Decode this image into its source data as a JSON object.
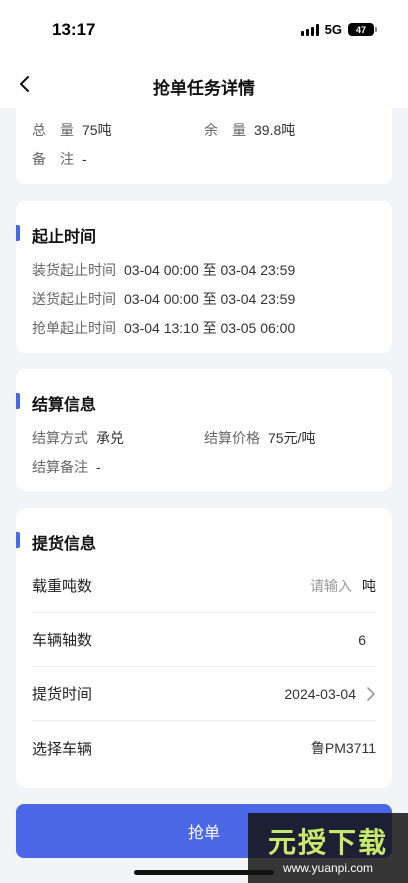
{
  "status": {
    "time": "13:17",
    "network": "5G",
    "battery": "47"
  },
  "nav": {
    "title": "抢单任务详情"
  },
  "summary": {
    "total_label": "总　量",
    "total_value": "75吨",
    "remain_label": "余　量",
    "remain_value": "39.8吨",
    "note_label": "备　注",
    "note_value": "-"
  },
  "time_section": {
    "title": "起止时间",
    "rows": [
      {
        "label": "装货起止时间",
        "value": "03-04 00:00 至 03-04 23:59"
      },
      {
        "label": "送货起止时间",
        "value": "03-04 00:00 至 03-04 23:59"
      },
      {
        "label": "抢单起止时间",
        "value": "03-04 13:10 至 03-05 06:00"
      }
    ]
  },
  "settle_section": {
    "title": "结算信息",
    "method_label": "结算方式",
    "method_value": "承兑",
    "price_label": "结算价格",
    "price_value": "75元/吨",
    "remark_label": "结算备注",
    "remark_value": "-"
  },
  "pickup_section": {
    "title": "提货信息",
    "tonnage_label": "载重吨数",
    "tonnage_placeholder": "请输入",
    "tonnage_unit": "吨",
    "axle_label": "车辆轴数",
    "axle_value": "6",
    "time_label": "提货时间",
    "time_value": "2024-03-04",
    "vehicle_label": "选择车辆",
    "vehicle_value": "鲁PM3711"
  },
  "submit_label": "抢单",
  "watermark": {
    "text": "元授下载",
    "url": "www.yuanpi.com"
  },
  "colors": {
    "accent": "#4a67e8",
    "background": "#f3f4f7"
  }
}
